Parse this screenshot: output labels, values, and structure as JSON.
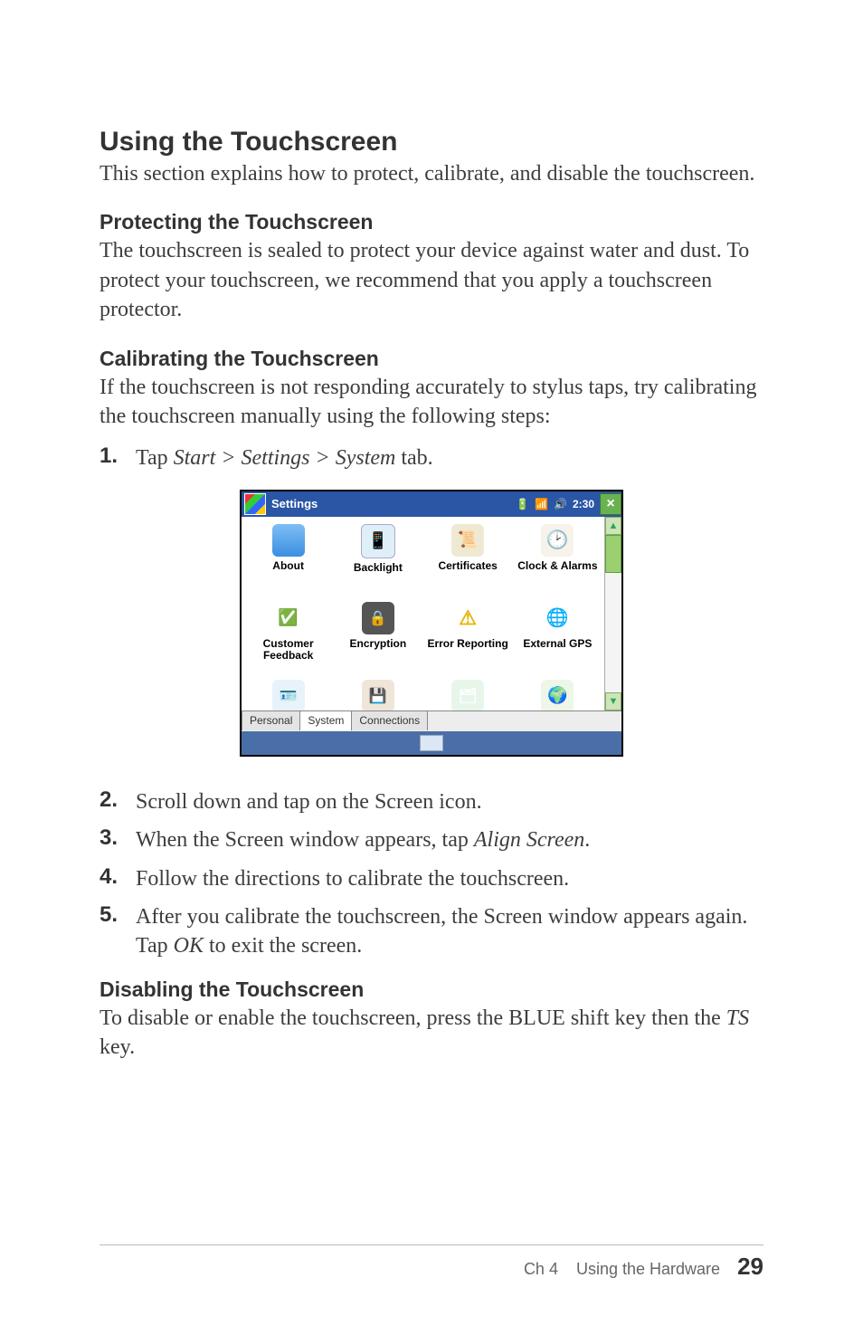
{
  "title": "Using the Touchscreen",
  "intro": "This section explains how to protect, calibrate, and disable the touchscreen.",
  "sections": {
    "protect": {
      "heading": "Protecting the Touchscreen",
      "body": "The touchscreen is sealed to protect your device against water and dust. To protect your touchscreen, we recommend that you apply a touchscreen protector."
    },
    "calibrate": {
      "heading": "Calibrating the Touchscreen",
      "body": "If the touchscreen is not responding accurately to stylus taps, try calibrating the touchscreen manually using the following steps:"
    },
    "disable": {
      "heading": "Disabling the Touchscreen",
      "body_pre": "To disable or enable the touchscreen, press the BLUE shift key then the ",
      "body_em": "TS",
      "body_post": " key."
    }
  },
  "steps": {
    "s1_pre": "Tap ",
    "s1_em": "Start > Settings > System",
    "s1_post": " tab.",
    "s2": "Scroll down and tap on the Screen icon.",
    "s3_pre": "When the Screen window appears, tap ",
    "s3_em": "Align Screen",
    "s3_post": ".",
    "s4": "Follow the directions to calibrate the touchscreen.",
    "s5_pre": "After you calibrate the touchscreen, the Screen window appears again. Tap ",
    "s5_em": "OK",
    "s5_post": " to exit the screen."
  },
  "screenshot": {
    "title": "Settings",
    "clock": "2:30",
    "close": "×",
    "tabs": {
      "personal": "Personal",
      "system": "System",
      "connections": "Connections"
    },
    "items": {
      "about": "About",
      "backlight": "Backlight",
      "certificates": "Certificates",
      "clock": "Clock & Alarms",
      "feedback": "Customer Feedback",
      "encryption": "Encryption",
      "error": "Error Reporting",
      "gps": "External GPS"
    }
  },
  "footer": {
    "chapter": "Ch 4",
    "name": "Using the Hardware",
    "page": "29"
  },
  "nums": {
    "n1": "1.",
    "n2": "2.",
    "n3": "3.",
    "n4": "4.",
    "n5": "5."
  }
}
